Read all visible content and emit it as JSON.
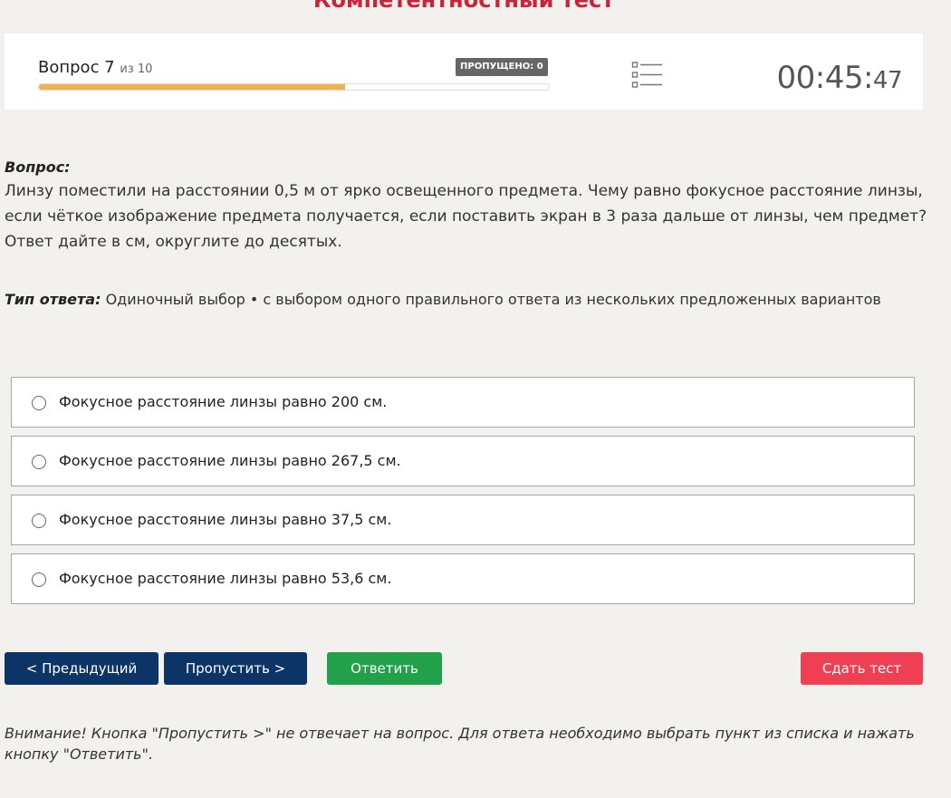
{
  "page": {
    "heading": "Компетентностный тест"
  },
  "header": {
    "question_word": "Вопрос 7",
    "of_total": "из 10",
    "skipped_label": "ПРОПУЩЕНО: 0",
    "progress": 0.6,
    "timer_main": "00:45:",
    "timer_seconds": "47",
    "list_icon": "list-icon"
  },
  "question": {
    "label": "Вопрос:",
    "text": "Линзу поместили на расстоянии 0,5 м от ярко освещенного предмета. Чему равно фокусное расстояние линзы, если чёткое изображение предмета получается, если поставить экран в 3 раза дальше от линзы, чем предмет? Ответ дайте в см, округлите до десятых."
  },
  "answer_type": {
    "label": "Тип ответа:",
    "value": "Одиночный выбор • с выбором одного правильного ответа из нескольких предложенных вариантов"
  },
  "options": [
    {
      "text": "Фокусное расстояние линзы равно 200 см."
    },
    {
      "text": "Фокусное расстояние линзы равно 267,5 см."
    },
    {
      "text": "Фокусное расстояние линзы равно 37,5 см."
    },
    {
      "text": "Фокусное расстояние линзы равно 53,6 см."
    }
  ],
  "buttons": {
    "prev": "< Предыдущий",
    "skip": "Пропустить >",
    "answer": "Ответить",
    "submit": "Сдать тест"
  },
  "notice": "Внимание! Кнопка \"Пропустить >\" не отвечает на вопрос. Для ответа необходимо выбрать пункт из списка и нажать кнопку \"Ответить\".",
  "colors": {
    "heading": "#c8243a",
    "progress": "#efb34a",
    "nav_button": "#0d3466",
    "answer_button": "#22a04a",
    "submit_button": "#ee3f53"
  }
}
